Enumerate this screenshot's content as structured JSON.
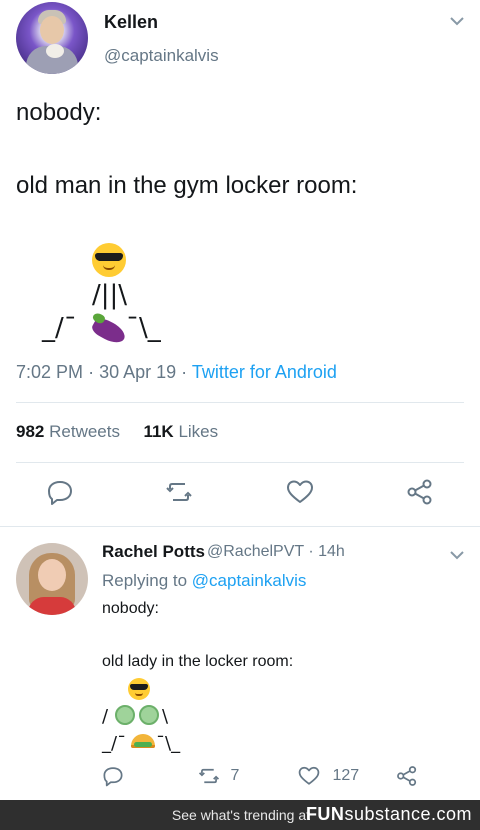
{
  "tweet": {
    "author_name": "Kellen",
    "author_handle": "@captainkalvis",
    "text_line1": "nobody:",
    "text_line2": "old man in the gym locker room:",
    "art": {
      "row2": "/||\\",
      "row3_left": "_/¯",
      "row3_right": "¯\\_"
    },
    "time": "7:02 PM",
    "date": "30 Apr 19",
    "source": "Twitter for Android",
    "retweets_count": "982",
    "retweets_label": "Retweets",
    "likes_count": "11K",
    "likes_label": "Likes",
    "icons": [
      "reply-icon",
      "retweet-icon",
      "like-icon",
      "share-icon",
      "chevron-down-icon"
    ]
  },
  "reply": {
    "author_name": "Rachel Potts",
    "author_handle": "@RachelPVT",
    "time_ago": "14h",
    "replying_prefix": "Replying to",
    "replying_to": "@captainkalvis",
    "text_line1": "nobody:",
    "text_line2": "old lady in the locker room:",
    "art": {
      "row2_left": "/",
      "row2_right": "\\",
      "row3_left": "_/¯",
      "row3_right": "¯\\_"
    },
    "retweet_count": "7",
    "like_count": "127"
  },
  "footer": {
    "text": "See what's trending at",
    "brand_bold": "FUN",
    "brand_rest": "substance.com"
  },
  "colors": {
    "link": "#1da1f2",
    "muted": "#657786",
    "text": "#14171a",
    "divider": "#e1e8ed",
    "footer_bg": "#2f2f2f"
  }
}
